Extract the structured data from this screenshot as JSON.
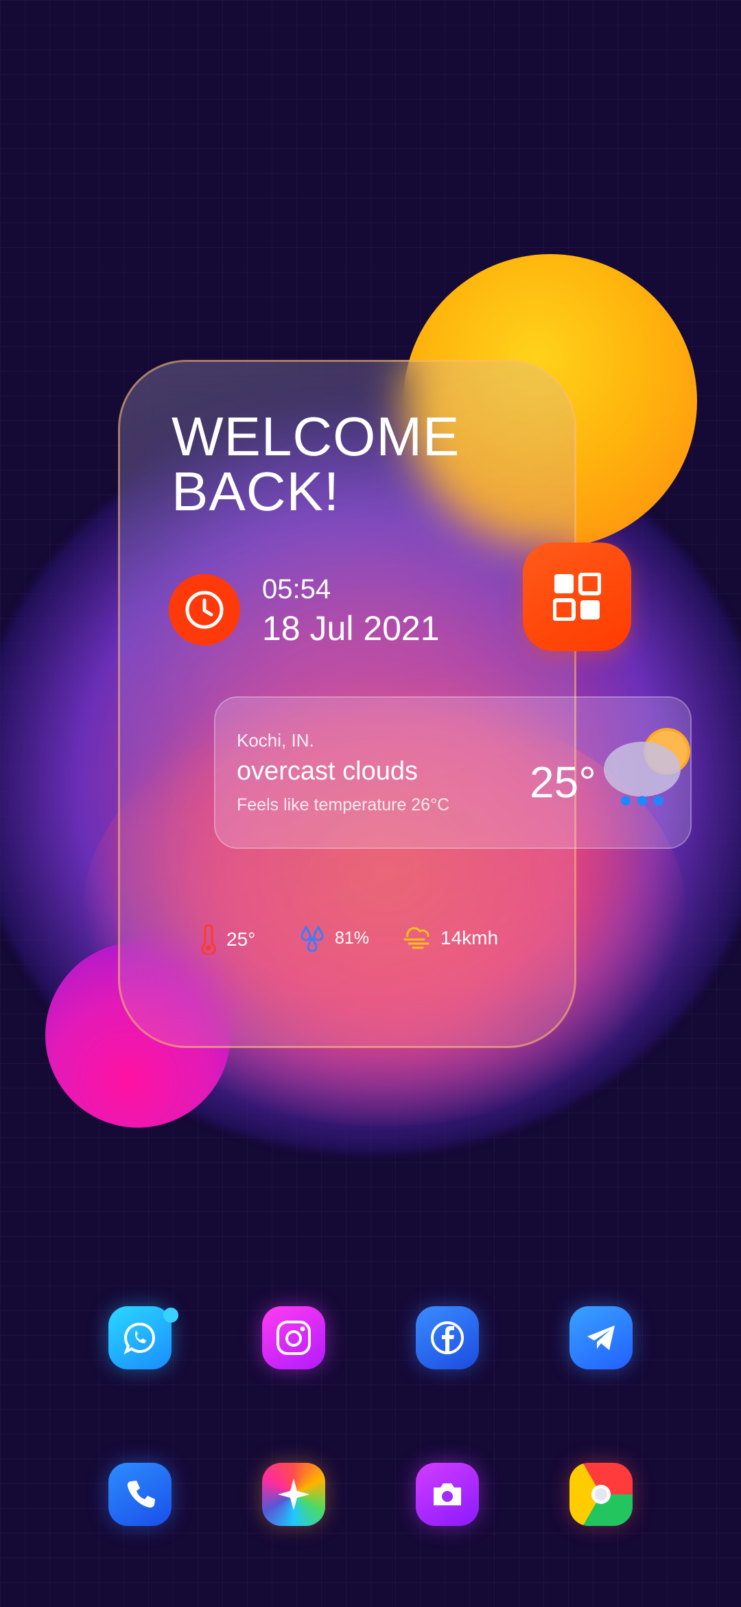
{
  "welcome": {
    "line1": "WELCOME",
    "line2": "BACK!"
  },
  "clock": {
    "time": "05:54",
    "date": "18 Jul 2021"
  },
  "weather": {
    "city": "Kochi, IN.",
    "condition": "overcast clouds",
    "feels_like": "Feels like temperature 26°C",
    "temperature": "25°",
    "icon": "cloud-sun-rain-icon"
  },
  "stats": {
    "temperature": {
      "icon": "thermometer-icon",
      "value": "25°"
    },
    "humidity": {
      "icon": "water-drops-icon",
      "value": "81%"
    },
    "wind": {
      "icon": "wind-icon",
      "value": "14kmh"
    }
  },
  "apps_row1": [
    {
      "name": "messenger-icon"
    },
    {
      "name": "instagram-icon"
    },
    {
      "name": "facebook-icon"
    },
    {
      "name": "telegram-icon"
    }
  ],
  "apps_row2": [
    {
      "name": "phone-icon"
    },
    {
      "name": "photos-icon"
    },
    {
      "name": "camera-icon"
    },
    {
      "name": "chrome-icon"
    }
  ],
  "colors": {
    "background": "#150936",
    "accent_orange": "#ff3b00",
    "sun_yellow": "#ffc300"
  }
}
